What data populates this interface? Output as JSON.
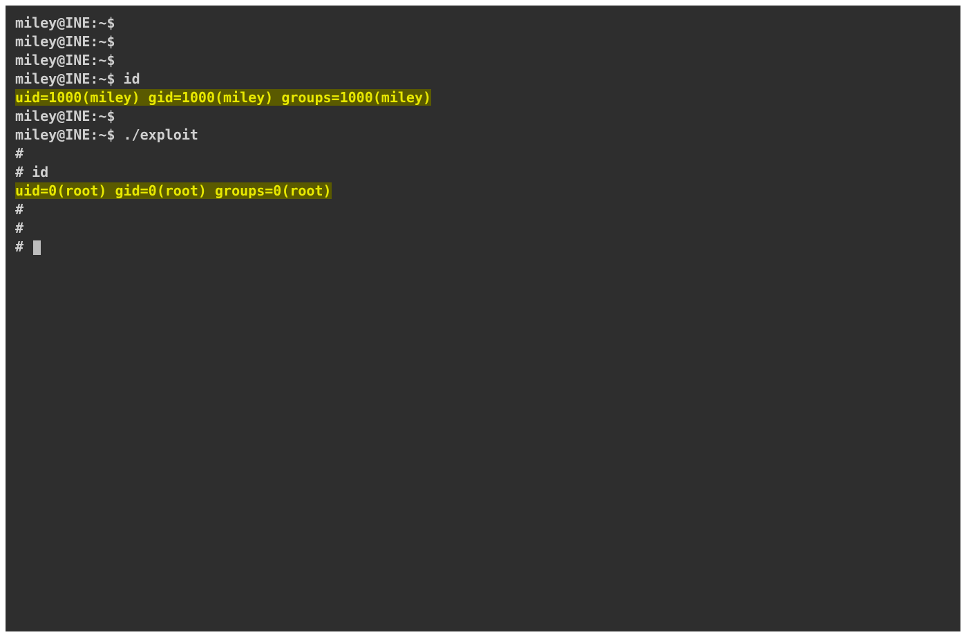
{
  "terminal": {
    "lines": [
      {
        "type": "prompt",
        "prompt": "miley@INE:~$",
        "command": ""
      },
      {
        "type": "prompt",
        "prompt": "miley@INE:~$",
        "command": ""
      },
      {
        "type": "prompt",
        "prompt": "miley@INE:~$",
        "command": ""
      },
      {
        "type": "prompt",
        "prompt": "miley@INE:~$",
        "command": "id"
      },
      {
        "type": "highlight",
        "text": "uid=1000(miley) gid=1000(miley) groups=1000(miley)"
      },
      {
        "type": "prompt",
        "prompt": "miley@INE:~$",
        "command": ""
      },
      {
        "type": "prompt",
        "prompt": "miley@INE:~$",
        "command": "./exploit"
      },
      {
        "type": "root",
        "prompt": "#",
        "command": ""
      },
      {
        "type": "root",
        "prompt": "#",
        "command": "id"
      },
      {
        "type": "highlight",
        "text": "uid=0(root) gid=0(root) groups=0(root)"
      },
      {
        "type": "root",
        "prompt": "#",
        "command": ""
      },
      {
        "type": "root",
        "prompt": "#",
        "command": ""
      },
      {
        "type": "root-cursor",
        "prompt": "#",
        "command": ""
      }
    ]
  }
}
